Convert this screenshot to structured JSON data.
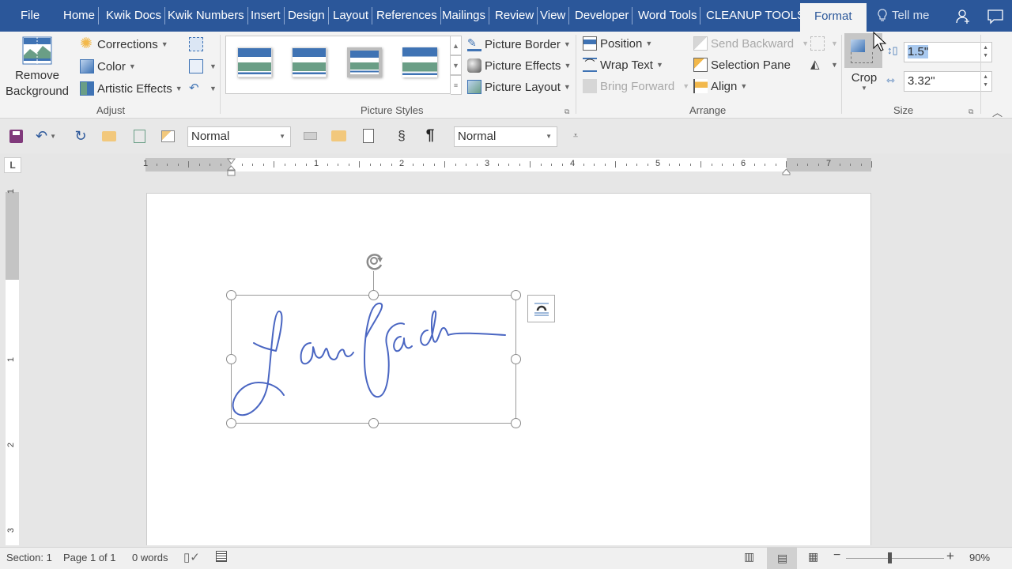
{
  "tabs": {
    "file": "File",
    "items": [
      "Home",
      "Kwik Docs",
      "Kwik Numbers",
      "Insert",
      "Design",
      "Layout",
      "References",
      "Mailings",
      "Review",
      "View",
      "Developer",
      "Word Tools",
      "CLEANUP TOOLS"
    ],
    "active": "Format",
    "tell_me": "Tell me"
  },
  "ribbon": {
    "adjust": {
      "label": "Adjust",
      "remove_background": [
        "Remove",
        "Background"
      ],
      "corrections": "Corrections",
      "color": "Color",
      "artistic_effects": "Artistic Effects"
    },
    "picture_styles": {
      "label": "Picture Styles",
      "picture_border": "Picture Border",
      "picture_effects": "Picture Effects",
      "picture_layout": "Picture Layout"
    },
    "arrange": {
      "label": "Arrange",
      "position": "Position",
      "wrap_text": "Wrap Text",
      "bring_forward": "Bring Forward",
      "send_backward": "Send Backward",
      "selection_pane": "Selection Pane",
      "align": "Align"
    },
    "size": {
      "label": "Size",
      "crop": "Crop",
      "height": "1.5\"",
      "width": "3.32\""
    }
  },
  "qat": {
    "style_left": "Normal",
    "style_right": "Normal",
    "section_symbol": "§",
    "pilcrow": "¶"
  },
  "ruler": {
    "h_labels": [
      "1",
      "1",
      "2",
      "3",
      "4",
      "5",
      "6",
      "7"
    ],
    "v_labels": [
      "1",
      "1",
      "2",
      "3"
    ]
  },
  "status": {
    "section": "Section: 1",
    "page": "Page 1 of 1",
    "words": "0 words",
    "zoom": "90%",
    "zoom_level_percent": 90
  },
  "colors": {
    "accent": "#2b579a",
    "signature_ink": "#4a66c2"
  }
}
